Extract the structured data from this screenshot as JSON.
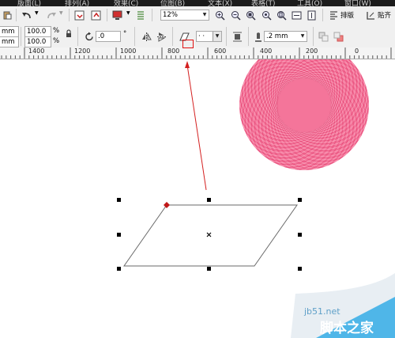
{
  "menubar": {
    "items": [
      "版面(L)",
      "排列(A)",
      "效果(C)",
      "位图(B)",
      "文本(X)",
      "表格(T)",
      "工具(O)",
      "窗口(W)"
    ]
  },
  "toolbar": {
    "zoom_value": "12%",
    "sort_label": "排版",
    "snap_label": "贴齐"
  },
  "property_bar": {
    "unit_fragment_top": "mm",
    "unit_fragment_bottom": "mm",
    "scale_x": "100.0",
    "scale_y": "100.0",
    "percent_top": "%",
    "percent_bottom": "%",
    "rotation_value": ".0",
    "rotation_unit": "°",
    "line_style_value": "· ·",
    "outline_width": ".2 mm"
  },
  "ruler": {
    "ticks": [
      "1400",
      "1200",
      "1000",
      "800",
      "600",
      "400",
      "200",
      "0"
    ]
  },
  "colors": {
    "circle": "#f2668e",
    "arrow": "#d42020",
    "highlight": "#e01010",
    "handle": "#000000",
    "node": "#c01818"
  },
  "watermark": {
    "site": "jb51.net",
    "brand": "脚本之家"
  }
}
